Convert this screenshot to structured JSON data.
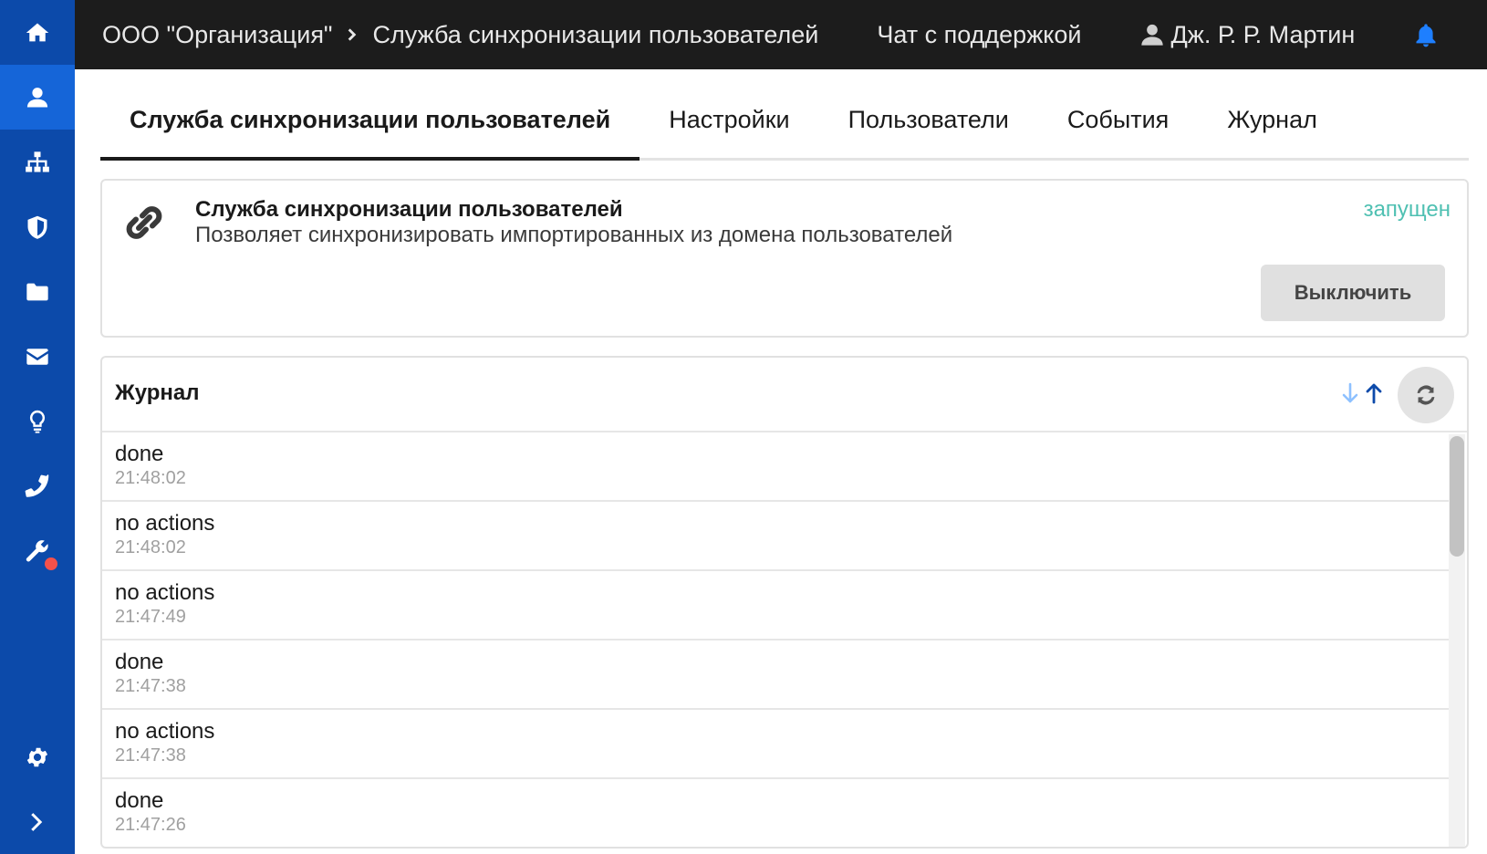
{
  "sidebar": {
    "items": [
      {
        "icon": "home-icon"
      },
      {
        "icon": "user-icon",
        "active": true
      },
      {
        "icon": "sitemap-icon"
      },
      {
        "icon": "shield-icon"
      },
      {
        "icon": "folder-icon"
      },
      {
        "icon": "envelope-icon"
      },
      {
        "icon": "lightbulb-icon"
      },
      {
        "icon": "phone-icon"
      },
      {
        "icon": "wrench-icon",
        "badge": true
      }
    ],
    "bottom": [
      {
        "icon": "gear-icon"
      },
      {
        "icon": "chevron-right-icon"
      }
    ]
  },
  "topbar": {
    "org": "ООО \"Организация\"",
    "service": "Служба синхронизации пользователей",
    "support": "Чат с поддержкой",
    "user": "Дж. Р. Р. Мартин"
  },
  "tabs": [
    {
      "label": "Служба синхронизации пользователей",
      "active": true
    },
    {
      "label": "Настройки"
    },
    {
      "label": "Пользователи"
    },
    {
      "label": "События"
    },
    {
      "label": "Журнал"
    }
  ],
  "service": {
    "title": "Служба синхронизации пользователей",
    "description": "Позволяет синхронизировать импортированных из домена пользователей",
    "status": "запущен",
    "status_color": "#4fc0b2",
    "button": "Выключить"
  },
  "journal": {
    "title": "Журнал",
    "entries": [
      {
        "message": "done",
        "time": "21:48:02"
      },
      {
        "message": "no actions",
        "time": "21:48:02"
      },
      {
        "message": "no actions",
        "time": "21:47:49"
      },
      {
        "message": "done",
        "time": "21:47:38"
      },
      {
        "message": "no actions",
        "time": "21:47:38"
      },
      {
        "message": "done",
        "time": "21:47:26"
      }
    ]
  },
  "colors": {
    "sidebar": "#0c4aaa",
    "sidebar_active": "#1565d8",
    "topbar": "#1c1c1c",
    "accent_blue": "#1e7fff"
  }
}
